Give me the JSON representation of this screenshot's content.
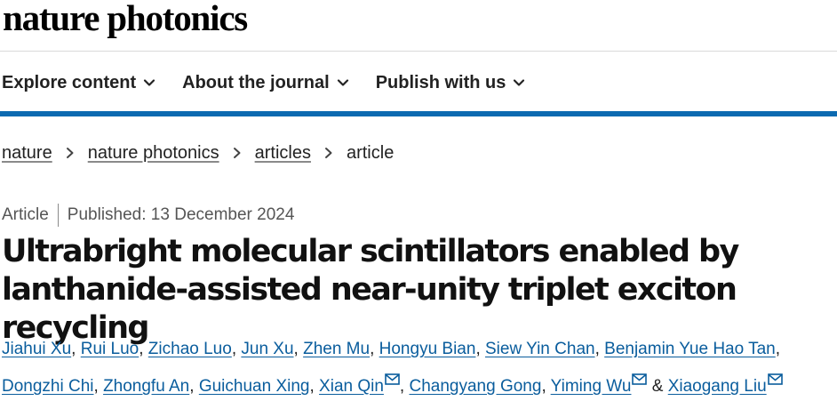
{
  "brand": {
    "name": "nature photonics"
  },
  "nav": {
    "items": [
      {
        "label": "Explore content"
      },
      {
        "label": "About the journal"
      },
      {
        "label": "Publish with us"
      }
    ]
  },
  "breadcrumb": {
    "links": [
      "nature",
      "nature photonics",
      "articles"
    ],
    "current": "article"
  },
  "meta": {
    "type": "Article",
    "published": "Published: 13 December 2024"
  },
  "article": {
    "title": "Ultrabright molecular scintillators enabled by lanthanide-assisted near-unity triplet exciton recycling"
  },
  "authors": {
    "line1": [
      "Jiahui Xu",
      "Rui Luo",
      "Zichao Luo",
      "Jun Xu",
      "Zhen Mu",
      "Hongyu Bian",
      "Siew Yin Chan",
      "Benjamin Yue Hao Tan"
    ],
    "line2": [
      "Dongzhi Chi",
      "Zhongfu An",
      "Guichuan Xing",
      "Xian Qin",
      "Changyang Gong",
      "Yiming Wu",
      "Xiaogang Liu"
    ],
    "separator": ",",
    "ampersand": "&"
  },
  "icons": {
    "nav_chevron": "chevron-down-icon",
    "crumb_separator": "chevron-right-icon",
    "corresponding": "mail-icon"
  },
  "colors": {
    "accent_bar": "#0c6ab1",
    "author_link": "#0a5d9d"
  }
}
